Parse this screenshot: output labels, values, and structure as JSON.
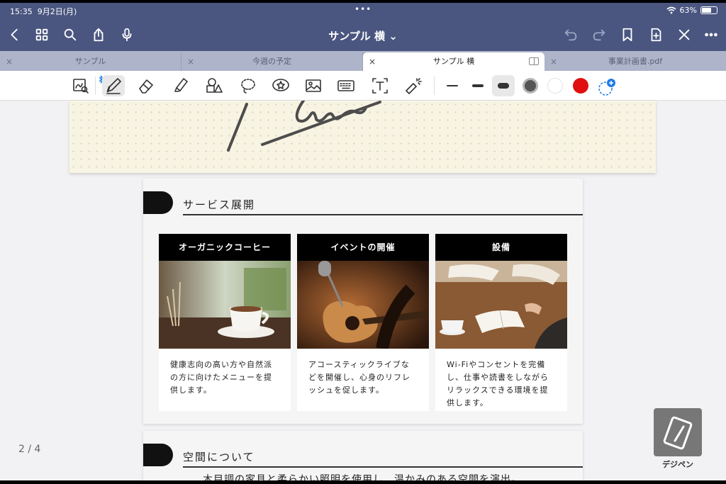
{
  "status": {
    "time": "15:35",
    "date": "9月2日(月)",
    "battery": "63%",
    "battery_level": 0.63,
    "more": "•••"
  },
  "nav": {
    "title": "サンプル 横 ⌄"
  },
  "tabs": [
    {
      "label": "サンプル",
      "active": false
    },
    {
      "label": "今週の予定",
      "active": false
    },
    {
      "label": "サンプル 横",
      "active": true
    },
    {
      "label": "事業計画書.pdf",
      "active": false
    }
  ],
  "toolbar": {
    "tools": [
      "zoom-window",
      "pen",
      "eraser",
      "highlighter",
      "shapes",
      "lasso",
      "sticker",
      "image",
      "keyboard",
      "text-box",
      "laser-pointer"
    ],
    "selected_tool": "pen",
    "stroke_widths": [
      "thin",
      "medium",
      "thick"
    ],
    "selected_width": "thick",
    "colors": {
      "gray": "#555555",
      "white": "#ffffff",
      "red": "#e01010"
    },
    "selected_color": "gray"
  },
  "page1": {
    "section_title": "サービス展開",
    "cards": [
      {
        "title": "オーガニックコーヒー",
        "text": [
          "健康志向の高い方や自然派",
          "の方に向けたメニューを提",
          "供します。"
        ]
      },
      {
        "title": "イベントの開催",
        "text": [
          "アコースティックライブな",
          "どを開催し、心身のリフレ",
          "ッシュを促します。"
        ]
      },
      {
        "title": "設備",
        "text": [
          "Wi-Fiやコンセントを完備",
          "し、仕事や読書をしながら",
          "リラックスできる環境を提",
          "供します。"
        ]
      }
    ]
  },
  "page2": {
    "section_title": "空間について",
    "text": "木目調の家具と柔らかい照明を使用し、温かみのある空間を演出。"
  },
  "page_indicator": "2 / 4",
  "watermark": "デジペン"
}
